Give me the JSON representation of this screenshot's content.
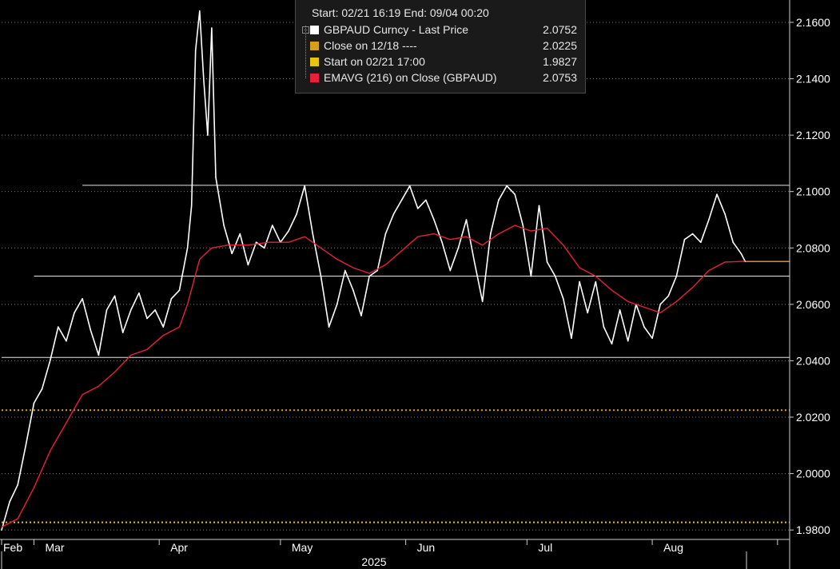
{
  "chart_data": {
    "type": "line",
    "ticker": "GBPAUD",
    "xlabel": "2025",
    "x_ticks": [
      "Feb",
      "Mar",
      "Apr",
      "May",
      "Jun",
      "Jul",
      "Aug"
    ],
    "x_range": [
      "2025-02-21",
      "2025-09-04"
    ],
    "ylim": [
      1.9775,
      2.1665
    ],
    "y_ticks": [
      "2.1600",
      "2.1400",
      "2.1200",
      "2.1000",
      "2.0800",
      "2.0600",
      "2.0400",
      "2.0200",
      "2.0000",
      "1.9800"
    ],
    "grid": "horizontal dotted",
    "legend": {
      "header": "Start: 02/21 16:19 End: 09/04 00:20",
      "position": "top-center",
      "entries": [
        {
          "label": "GBPAUD Curncy - Last Price",
          "value": "2.0752",
          "color": "#ffffff"
        },
        {
          "label": "Close on 12/18 ----",
          "value": "2.0225",
          "color": "#d4a017"
        },
        {
          "label": "Start on 02/21 17:00",
          "value": "1.9827",
          "color": "#e8c40a"
        },
        {
          "label": "EMAVG (216)  on Close (GBPAUD)",
          "value": "2.0753",
          "color": "#e8203a"
        }
      ]
    },
    "reference_lines": [
      {
        "kind": "close",
        "y": 2.0225,
        "color": "#d4a017",
        "style": "dotted"
      },
      {
        "kind": "start",
        "y": 1.9827,
        "color": "#e8c40a",
        "style": "dotted"
      },
      {
        "kind": "last",
        "y": 2.0752,
        "color": "#f0a020",
        "style": "solid"
      }
    ],
    "support_resistance_lines": [
      {
        "y": 2.1022,
        "x_start": "2025-03-13",
        "x_end": "2025-09-04"
      },
      {
        "y": 2.07,
        "x_start": "2025-03-01",
        "x_end": "2025-09-04"
      },
      {
        "y": 2.0412,
        "x_start": "2025-02-21",
        "x_end": "2025-09-04"
      }
    ],
    "series": [
      {
        "name": "GBPAUD Curncy - Last Price",
        "color": "#ffffff",
        "points": [
          [
            "2025-02-21",
            1.98
          ],
          [
            "2025-02-23",
            1.99
          ],
          [
            "2025-02-25",
            1.996
          ],
          [
            "2025-02-27",
            2.01
          ],
          [
            "2025-03-01",
            2.025
          ],
          [
            "2025-03-03",
            2.03
          ],
          [
            "2025-03-05",
            2.04
          ],
          [
            "2025-03-07",
            2.052
          ],
          [
            "2025-03-09",
            2.047
          ],
          [
            "2025-03-11",
            2.057
          ],
          [
            "2025-03-13",
            2.062
          ],
          [
            "2025-03-15",
            2.051
          ],
          [
            "2025-03-17",
            2.042
          ],
          [
            "2025-03-19",
            2.058
          ],
          [
            "2025-03-21",
            2.063
          ],
          [
            "2025-03-23",
            2.05
          ],
          [
            "2025-03-25",
            2.058
          ],
          [
            "2025-03-27",
            2.064
          ],
          [
            "2025-03-29",
            2.055
          ],
          [
            "2025-03-31",
            2.058
          ],
          [
            "2025-04-02",
            2.052
          ],
          [
            "2025-04-04",
            2.062
          ],
          [
            "2025-04-06",
            2.065
          ],
          [
            "2025-04-08",
            2.08
          ],
          [
            "2025-04-09",
            2.095
          ],
          [
            "2025-04-10",
            2.15
          ],
          [
            "2025-04-11",
            2.164
          ],
          [
            "2025-04-12",
            2.14
          ],
          [
            "2025-04-13",
            2.12
          ],
          [
            "2025-04-14",
            2.158
          ],
          [
            "2025-04-15",
            2.105
          ],
          [
            "2025-04-17",
            2.088
          ],
          [
            "2025-04-19",
            2.078
          ],
          [
            "2025-04-21",
            2.085
          ],
          [
            "2025-04-23",
            2.074
          ],
          [
            "2025-04-25",
            2.082
          ],
          [
            "2025-04-27",
            2.08
          ],
          [
            "2025-04-29",
            2.088
          ],
          [
            "2025-05-01",
            2.082
          ],
          [
            "2025-05-03",
            2.086
          ],
          [
            "2025-05-05",
            2.092
          ],
          [
            "2025-05-07",
            2.102
          ],
          [
            "2025-05-09",
            2.085
          ],
          [
            "2025-05-11",
            2.07
          ],
          [
            "2025-05-13",
            2.052
          ],
          [
            "2025-05-15",
            2.06
          ],
          [
            "2025-05-17",
            2.072
          ],
          [
            "2025-05-19",
            2.065
          ],
          [
            "2025-05-21",
            2.056
          ],
          [
            "2025-05-23",
            2.07
          ],
          [
            "2025-05-25",
            2.072
          ],
          [
            "2025-05-27",
            2.085
          ],
          [
            "2025-05-29",
            2.092
          ],
          [
            "2025-05-31",
            2.097
          ],
          [
            "2025-06-02",
            2.102
          ],
          [
            "2025-06-04",
            2.094
          ],
          [
            "2025-06-06",
            2.097
          ],
          [
            "2025-06-08",
            2.09
          ],
          [
            "2025-06-10",
            2.082
          ],
          [
            "2025-06-12",
            2.072
          ],
          [
            "2025-06-14",
            2.08
          ],
          [
            "2025-06-16",
            2.09
          ],
          [
            "2025-06-18",
            2.075
          ],
          [
            "2025-06-20",
            2.061
          ],
          [
            "2025-06-22",
            2.085
          ],
          [
            "2025-06-24",
            2.097
          ],
          [
            "2025-06-26",
            2.102
          ],
          [
            "2025-06-28",
            2.099
          ],
          [
            "2025-06-30",
            2.088
          ],
          [
            "2025-07-02",
            2.07
          ],
          [
            "2025-07-04",
            2.095
          ],
          [
            "2025-07-06",
            2.075
          ],
          [
            "2025-07-08",
            2.07
          ],
          [
            "2025-07-10",
            2.062
          ],
          [
            "2025-07-12",
            2.048
          ],
          [
            "2025-07-14",
            2.068
          ],
          [
            "2025-07-16",
            2.057
          ],
          [
            "2025-07-18",
            2.068
          ],
          [
            "2025-07-20",
            2.052
          ],
          [
            "2025-07-22",
            2.046
          ],
          [
            "2025-07-24",
            2.058
          ],
          [
            "2025-07-26",
            2.047
          ],
          [
            "2025-07-28",
            2.06
          ],
          [
            "2025-07-30",
            2.052
          ],
          [
            "2025-08-01",
            2.048
          ],
          [
            "2025-08-03",
            2.06
          ],
          [
            "2025-08-05",
            2.063
          ],
          [
            "2025-08-07",
            2.07
          ],
          [
            "2025-08-09",
            2.083
          ],
          [
            "2025-08-11",
            2.085
          ],
          [
            "2025-08-13",
            2.082
          ],
          [
            "2025-08-15",
            2.09
          ],
          [
            "2025-08-17",
            2.099
          ],
          [
            "2025-08-19",
            2.092
          ],
          [
            "2025-08-21",
            2.082
          ],
          [
            "2025-08-23",
            2.078
          ],
          [
            "2025-08-24",
            2.0752
          ]
        ]
      },
      {
        "name": "EMAVG (216)  on Close (GBPAUD)",
        "color": "#e8203a",
        "points": [
          [
            "2025-02-21",
            1.981
          ],
          [
            "2025-02-25",
            1.984
          ],
          [
            "2025-03-01",
            1.995
          ],
          [
            "2025-03-05",
            2.008
          ],
          [
            "2025-03-09",
            2.018
          ],
          [
            "2025-03-13",
            2.028
          ],
          [
            "2025-03-17",
            2.031
          ],
          [
            "2025-03-21",
            2.036
          ],
          [
            "2025-03-25",
            2.042
          ],
          [
            "2025-03-29",
            2.044
          ],
          [
            "2025-04-02",
            2.049
          ],
          [
            "2025-04-06",
            2.052
          ],
          [
            "2025-04-08",
            2.06
          ],
          [
            "2025-04-11",
            2.076
          ],
          [
            "2025-04-14",
            2.08
          ],
          [
            "2025-04-18",
            2.081
          ],
          [
            "2025-04-23",
            2.081
          ],
          [
            "2025-04-28",
            2.082
          ],
          [
            "2025-05-03",
            2.082
          ],
          [
            "2025-05-07",
            2.084
          ],
          [
            "2025-05-11",
            2.08
          ],
          [
            "2025-05-15",
            2.076
          ],
          [
            "2025-05-19",
            2.073
          ],
          [
            "2025-05-23",
            2.071
          ],
          [
            "2025-05-27",
            2.074
          ],
          [
            "2025-05-31",
            2.079
          ],
          [
            "2025-06-04",
            2.084
          ],
          [
            "2025-06-08",
            2.085
          ],
          [
            "2025-06-12",
            2.083
          ],
          [
            "2025-06-16",
            2.084
          ],
          [
            "2025-06-20",
            2.081
          ],
          [
            "2025-06-24",
            2.085
          ],
          [
            "2025-06-28",
            2.088
          ],
          [
            "2025-07-02",
            2.086
          ],
          [
            "2025-07-06",
            2.087
          ],
          [
            "2025-07-10",
            2.081
          ],
          [
            "2025-07-14",
            2.073
          ],
          [
            "2025-07-18",
            2.07
          ],
          [
            "2025-07-22",
            2.065
          ],
          [
            "2025-07-26",
            2.061
          ],
          [
            "2025-07-30",
            2.059
          ],
          [
            "2025-08-03",
            2.057
          ],
          [
            "2025-08-07",
            2.061
          ],
          [
            "2025-08-11",
            2.066
          ],
          [
            "2025-08-15",
            2.072
          ],
          [
            "2025-08-19",
            2.075
          ],
          [
            "2025-08-24",
            2.0753
          ]
        ]
      }
    ]
  }
}
